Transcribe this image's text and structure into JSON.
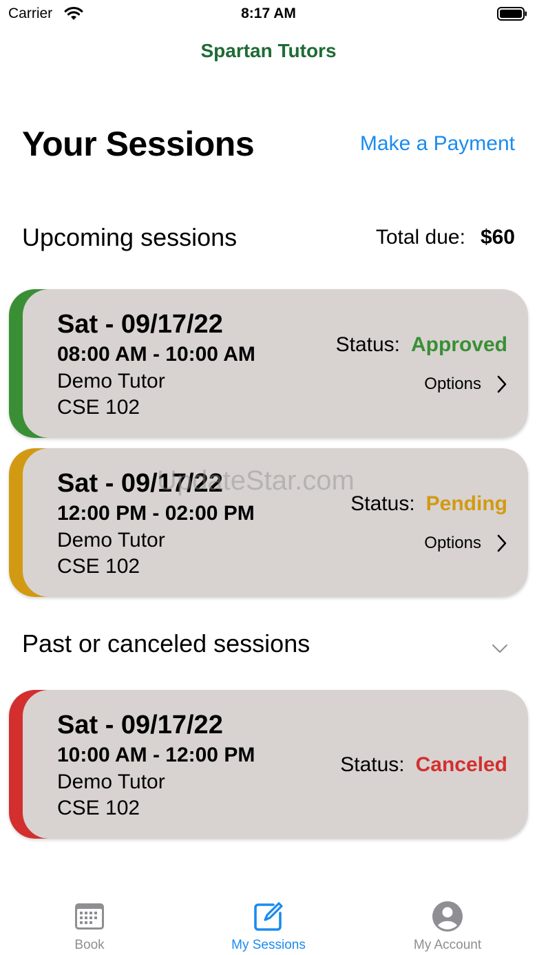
{
  "status_bar": {
    "carrier": "Carrier",
    "time": "8:17 AM"
  },
  "app": {
    "title": "Spartan Tutors"
  },
  "header": {
    "title": "Your Sessions",
    "payment_link": "Make a Payment"
  },
  "upcoming": {
    "title": "Upcoming sessions",
    "total_due_label": "Total due:",
    "total_due_amount": "$60",
    "sessions": [
      {
        "date": "Sat - 09/17/22",
        "time": "08:00 AM - 10:00 AM",
        "tutor": "Demo Tutor",
        "course": "CSE 102",
        "status_label": "Status:",
        "status": "Approved",
        "status_color": "#3a8f35",
        "options_label": "Options"
      },
      {
        "date": "Sat - 09/17/22",
        "time": "12:00 PM - 02:00 PM",
        "tutor": "Demo Tutor",
        "course": "CSE 102",
        "status_label": "Status:",
        "status": "Pending",
        "status_color": "#d29a12",
        "options_label": "Options"
      }
    ]
  },
  "past": {
    "title": "Past or canceled sessions",
    "sessions": [
      {
        "date": "Sat - 09/17/22",
        "time": "10:00 AM - 12:00 PM",
        "tutor": "Demo Tutor",
        "course": "CSE 102",
        "status_label": "Status:",
        "status": "Canceled",
        "status_color": "#d32f2f"
      }
    ]
  },
  "watermark": "UpdateStar.com",
  "tabs": [
    {
      "label": "Book",
      "icon": "calendar-icon",
      "active": false
    },
    {
      "label": "My Sessions",
      "icon": "edit-icon",
      "active": true
    },
    {
      "label": "My Account",
      "icon": "account-icon",
      "active": false
    }
  ],
  "colors": {
    "brand": "#1f6b35",
    "link": "#1a8bf0",
    "card_bg": "#d8d3d1"
  }
}
